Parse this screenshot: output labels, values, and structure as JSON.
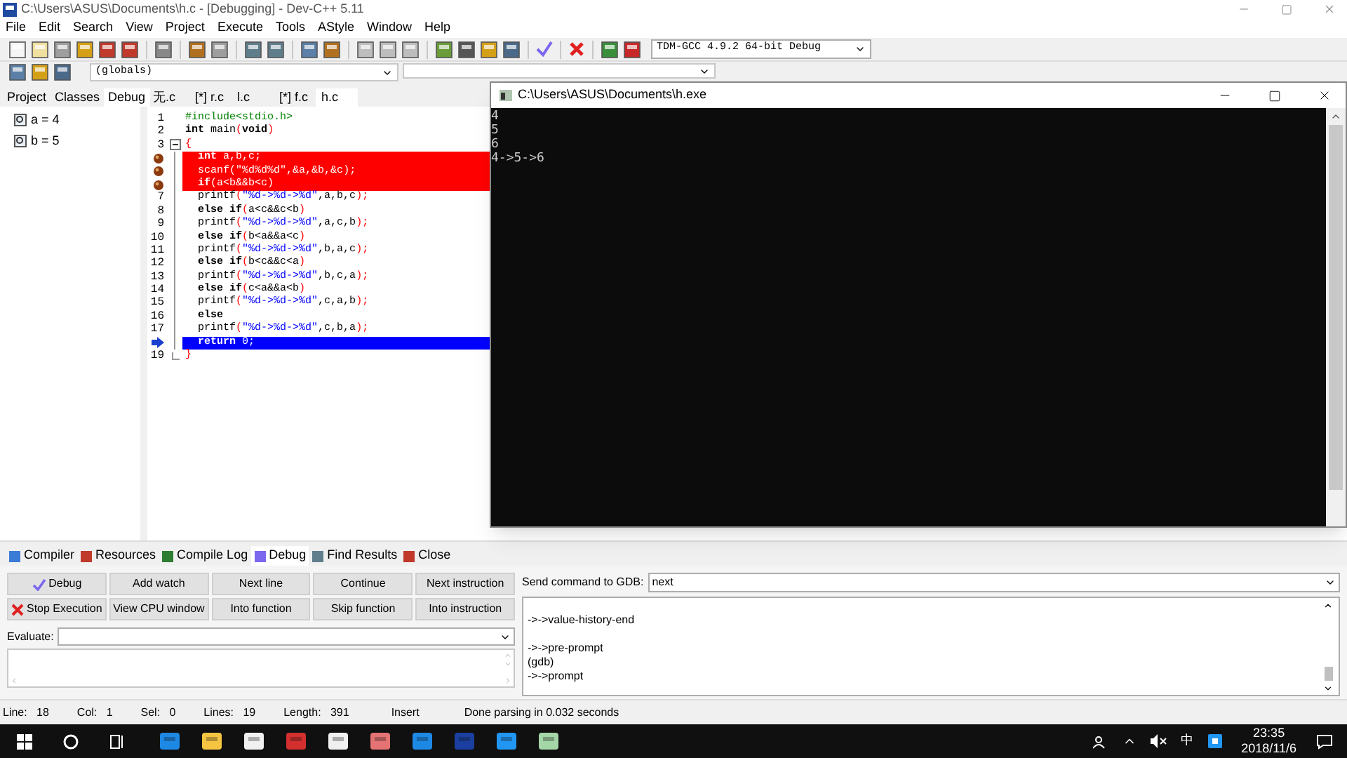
{
  "window": {
    "title": "C:\\Users\\ASUS\\Documents\\h.c - [Debugging] - Dev-C++ 5.11"
  },
  "menu": [
    "File",
    "Edit",
    "Search",
    "View",
    "Project",
    "Execute",
    "Tools",
    "AStyle",
    "Window",
    "Help"
  ],
  "toolbar": {
    "compiler": "TDM-GCC 4.9.2 64-bit Debug",
    "scope": "(globals)"
  },
  "left_panel": {
    "tabs": [
      {
        "label": "Project",
        "selected": false
      },
      {
        "label": "Classes",
        "selected": false
      },
      {
        "label": "Debug",
        "selected": true
      }
    ],
    "watches": [
      "a = 4",
      "b = 5"
    ]
  },
  "editor": {
    "tabs": [
      {
        "label": "无.c",
        "selected": false
      },
      {
        "label": "[*] r.c",
        "selected": false
      },
      {
        "label": "l.c",
        "selected": false
      },
      {
        "label": "[*] f.c",
        "selected": false
      },
      {
        "label": "h.c",
        "selected": true
      }
    ],
    "lines": [
      {
        "number": "1",
        "breakpoint": false,
        "current": false,
        "tokens": [
          {
            "t": "#include<stdio.h>",
            "kind": "pre"
          }
        ]
      },
      {
        "number": "2",
        "breakpoint": false,
        "current": false,
        "tokens": [
          {
            "t": "int",
            "kind": "kw"
          },
          {
            "t": " main",
            "kind": "id"
          },
          {
            "t": "(",
            "kind": "sym"
          },
          {
            "t": "void",
            "kind": "kw"
          },
          {
            "t": ")",
            "kind": "sym"
          }
        ]
      },
      {
        "number": "3",
        "breakpoint": false,
        "current": false,
        "fold_start": true,
        "tokens": [
          {
            "t": "{",
            "kind": "sym"
          }
        ]
      },
      {
        "breakpoint": true,
        "current": false,
        "tokens": [
          {
            "t": "  int",
            "kind": "kw"
          },
          {
            "t": " a,b,c;",
            "kind": "id"
          }
        ]
      },
      {
        "breakpoint": true,
        "current": false,
        "tokens": [
          {
            "t": "  scanf",
            "kind": "id"
          },
          {
            "t": "(",
            "kind": "sym"
          },
          {
            "t": "\"%d%d%d\"",
            "kind": "str"
          },
          {
            "t": ",&a,&b,&c",
            "kind": "id"
          },
          {
            "t": ");",
            "kind": "sym"
          }
        ]
      },
      {
        "breakpoint": true,
        "current": false,
        "tokens": [
          {
            "t": "  if",
            "kind": "kw"
          },
          {
            "t": "(",
            "kind": "sym"
          },
          {
            "t": "a<b&&b<c",
            "kind": "id"
          },
          {
            "t": ")",
            "kind": "sym"
          }
        ]
      },
      {
        "number": "7",
        "breakpoint": false,
        "current": false,
        "tokens": [
          {
            "t": "  printf",
            "kind": "id"
          },
          {
            "t": "(",
            "kind": "sym"
          },
          {
            "t": "\"%d->%d->%d\"",
            "kind": "str"
          },
          {
            "t": ",a,b,c",
            "kind": "id"
          },
          {
            "t": ");",
            "kind": "sym"
          }
        ]
      },
      {
        "number": "8",
        "breakpoint": false,
        "current": false,
        "tokens": [
          {
            "t": "  else if",
            "kind": "kw"
          },
          {
            "t": "(",
            "kind": "sym"
          },
          {
            "t": "a<c&&c<b",
            "kind": "id"
          },
          {
            "t": ")",
            "kind": "sym"
          }
        ]
      },
      {
        "number": "9",
        "breakpoint": false,
        "current": false,
        "tokens": [
          {
            "t": "  printf",
            "kind": "id"
          },
          {
            "t": "(",
            "kind": "sym"
          },
          {
            "t": "\"%d->%d->%d\"",
            "kind": "str"
          },
          {
            "t": ",a,c,b",
            "kind": "id"
          },
          {
            "t": ");",
            "kind": "sym"
          }
        ]
      },
      {
        "number": "10",
        "breakpoint": false,
        "current": false,
        "tokens": [
          {
            "t": "  else if",
            "kind": "kw"
          },
          {
            "t": "(",
            "kind": "sym"
          },
          {
            "t": "b<a&&a<c",
            "kind": "id"
          },
          {
            "t": ")",
            "kind": "sym"
          }
        ]
      },
      {
        "number": "11",
        "breakpoint": false,
        "current": false,
        "tokens": [
          {
            "t": "  printf",
            "kind": "id"
          },
          {
            "t": "(",
            "kind": "sym"
          },
          {
            "t": "\"%d->%d->%d\"",
            "kind": "str"
          },
          {
            "t": ",b,a,c",
            "kind": "id"
          },
          {
            "t": ");",
            "kind": "sym"
          }
        ]
      },
      {
        "number": "12",
        "breakpoint": false,
        "current": false,
        "tokens": [
          {
            "t": "  else if",
            "kind": "kw"
          },
          {
            "t": "(",
            "kind": "sym"
          },
          {
            "t": "b<c&&c<a",
            "kind": "id"
          },
          {
            "t": ")",
            "kind": "sym"
          }
        ]
      },
      {
        "number": "13",
        "breakpoint": false,
        "current": false,
        "tokens": [
          {
            "t": "  printf",
            "kind": "id"
          },
          {
            "t": "(",
            "kind": "sym"
          },
          {
            "t": "\"%d->%d->%d\"",
            "kind": "str"
          },
          {
            "t": ",b,c,a",
            "kind": "id"
          },
          {
            "t": ");",
            "kind": "sym"
          }
        ]
      },
      {
        "number": "14",
        "breakpoint": false,
        "current": false,
        "tokens": [
          {
            "t": "  else if",
            "kind": "kw"
          },
          {
            "t": "(",
            "kind": "sym"
          },
          {
            "t": "c<a&&a<b",
            "kind": "id"
          },
          {
            "t": ")",
            "kind": "sym"
          }
        ]
      },
      {
        "number": "15",
        "breakpoint": false,
        "current": false,
        "tokens": [
          {
            "t": "  printf",
            "kind": "id"
          },
          {
            "t": "(",
            "kind": "sym"
          },
          {
            "t": "\"%d->%d->%d\"",
            "kind": "str"
          },
          {
            "t": ",c,a,b",
            "kind": "id"
          },
          {
            "t": ");",
            "kind": "sym"
          }
        ]
      },
      {
        "number": "16",
        "breakpoint": false,
        "current": false,
        "tokens": [
          {
            "t": "  else",
            "kind": "kw"
          }
        ]
      },
      {
        "number": "17",
        "breakpoint": false,
        "current": false,
        "tokens": [
          {
            "t": "  printf",
            "kind": "id"
          },
          {
            "t": "(",
            "kind": "sym"
          },
          {
            "t": "\"%d->%d->%d\"",
            "kind": "str"
          },
          {
            "t": ",c,b,a",
            "kind": "id"
          },
          {
            "t": ");",
            "kind": "sym"
          }
        ]
      },
      {
        "breakpoint": false,
        "current": true,
        "tokens": [
          {
            "t": "  return",
            "kind": "kw"
          },
          {
            "t": " 0",
            "kind": "id"
          },
          {
            "t": ";",
            "kind": "sym"
          }
        ]
      },
      {
        "number": "19",
        "breakpoint": false,
        "current": false,
        "fold_end": true,
        "tokens": [
          {
            "t": "}",
            "kind": "sym"
          }
        ]
      }
    ]
  },
  "console": {
    "title": "C:\\Users\\ASUS\\Documents\\h.exe",
    "lines": [
      "4",
      "5",
      "6",
      "4->5->6"
    ]
  },
  "bottom_panel": {
    "tabs": [
      {
        "label": "Compiler",
        "selected": false
      },
      {
        "label": "Resources",
        "selected": false
      },
      {
        "label": "Compile Log",
        "selected": false
      },
      {
        "label": "Debug",
        "selected": true
      },
      {
        "label": "Find Results",
        "selected": false
      },
      {
        "label": "Close",
        "selected": false
      }
    ],
    "buttons": [
      {
        "label": "Debug",
        "kind": "check"
      },
      {
        "label": "Add watch",
        "kind": "plain"
      },
      {
        "label": "Next line",
        "kind": "plain"
      },
      {
        "label": "Continue",
        "kind": "plain"
      },
      {
        "label": "Next instruction",
        "kind": "plain"
      },
      {
        "label": "Stop Execution",
        "kind": "stop"
      },
      {
        "label": "View CPU window",
        "kind": "plain"
      },
      {
        "label": "Into function",
        "kind": "plain"
      },
      {
        "label": "Skip function",
        "kind": "plain"
      },
      {
        "label": "Into instruction",
        "kind": "plain"
      }
    ],
    "evaluate": {
      "label": "Evaluate:"
    },
    "gdb": {
      "label": "Send command to GDB:",
      "value": "next",
      "output": [
        [
          "->->value-history-end"
        ],
        [
          "->->pre-prompt",
          "(gdb)",
          "->->prompt"
        ]
      ]
    }
  },
  "status_bar": {
    "fields": [
      {
        "label": "Line:",
        "value": "18"
      },
      {
        "label": "Col:",
        "value": "1"
      },
      {
        "label": "Sel:",
        "value": "0"
      },
      {
        "label": "Lines:",
        "value": "19"
      },
      {
        "label": "Length:",
        "value": "391"
      }
    ],
    "mode": "Insert",
    "message": "Done parsing in 0.032 seconds"
  },
  "taskbar": {
    "ime": "中",
    "time": "23:35",
    "date": "2018/11/6"
  }
}
